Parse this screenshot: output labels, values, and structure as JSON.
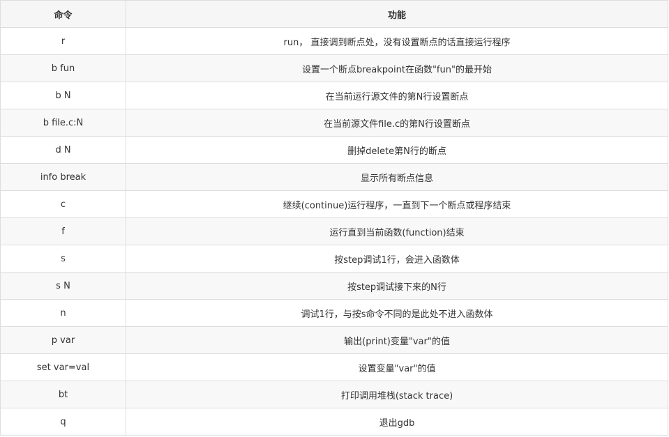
{
  "table": {
    "headers": {
      "command": "命令",
      "function": "功能"
    },
    "rows": [
      {
        "cmd": "r",
        "desc": "run， 直接调到断点处，没有设置断点的话直接运行程序"
      },
      {
        "cmd": "b fun",
        "desc": "设置一个断点breakpoint在函数\"fun\"的最开始"
      },
      {
        "cmd": "b N",
        "desc": "在当前运行源文件的第N行设置断点"
      },
      {
        "cmd": "b file.c:N",
        "desc": "在当前源文件file.c的第N行设置断点"
      },
      {
        "cmd": "d N",
        "desc": "删掉delete第N行的断点"
      },
      {
        "cmd": "info break",
        "desc": "显示所有断点信息"
      },
      {
        "cmd": "c",
        "desc": "继续(continue)运行程序，一直到下一个断点或程序结束"
      },
      {
        "cmd": "f",
        "desc": "运行直到当前函数(function)结束"
      },
      {
        "cmd": "s",
        "desc": "按step调试1行，会进入函数体"
      },
      {
        "cmd": "s N",
        "desc": "按step调试接下来的N行"
      },
      {
        "cmd": "n",
        "desc": "调试1行，与按s命令不同的是此处不进入函数体"
      },
      {
        "cmd": "p var",
        "desc": "输出(print)变量\"var\"的值"
      },
      {
        "cmd": "set var=val",
        "desc": "设置变量\"var\"的值"
      },
      {
        "cmd": "bt",
        "desc": "打印调用堆栈(stack trace)"
      },
      {
        "cmd": "q",
        "desc": "退出gdb"
      }
    ]
  }
}
